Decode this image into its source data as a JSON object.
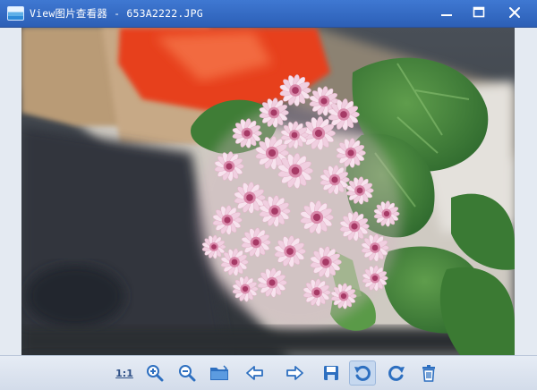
{
  "window": {
    "title": "View图片查看器 - 653A2222.JPG",
    "controls": {
      "minimize": "minimize-icon",
      "maximize": "maximize-icon",
      "close": "close-icon"
    }
  },
  "viewer": {
    "image_subject": "photo-flowers",
    "colors": {
      "titlebar": "#2c5fb6",
      "toolbar_icon": "#2d6fc0",
      "viewport_bg": "#e4eaf2"
    }
  },
  "toolbar": {
    "actual_size_label": "1:1",
    "buttons": [
      {
        "icon": "actual-size-icon"
      },
      {
        "icon": "zoom-in-icon"
      },
      {
        "icon": "zoom-out-icon"
      },
      {
        "icon": "open-folder-icon"
      },
      {
        "icon": "previous-icon"
      },
      {
        "icon": "next-icon"
      },
      {
        "icon": "save-icon"
      },
      {
        "icon": "rotate-left-icon",
        "active": true
      },
      {
        "icon": "rotate-right-icon"
      },
      {
        "icon": "delete-icon"
      }
    ]
  }
}
